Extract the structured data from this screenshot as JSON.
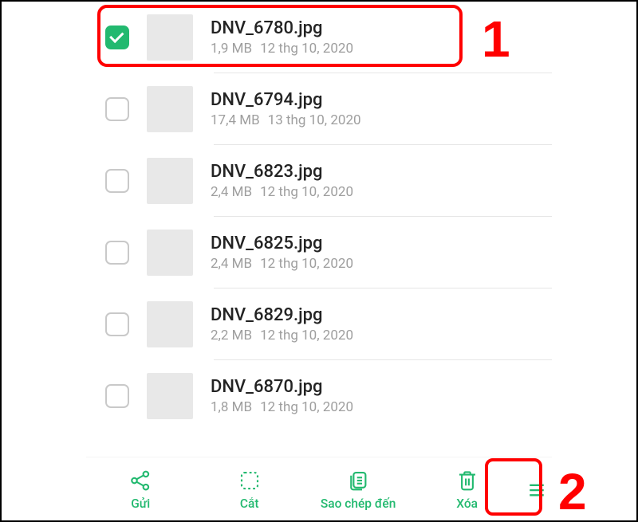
{
  "annotations": {
    "marker1": "1",
    "marker2": "2"
  },
  "files": [
    {
      "name": "DNV_6780.jpg",
      "size": "1,9 MB",
      "date": "12 thg 10, 2020",
      "checked": true
    },
    {
      "name": "DNV_6794.jpg",
      "size": "17,4 MB",
      "date": "13 thg 10, 2020",
      "checked": false
    },
    {
      "name": "DNV_6823.jpg",
      "size": "2,4 MB",
      "date": "12 thg 10, 2020",
      "checked": false
    },
    {
      "name": "DNV_6825.jpg",
      "size": "2,4 MB",
      "date": "12 thg 10, 2020",
      "checked": false
    },
    {
      "name": "DNV_6829.jpg",
      "size": "2,2 MB",
      "date": "12 thg 10, 2020",
      "checked": false
    },
    {
      "name": "DNV_6870.jpg",
      "size": "1,8 MB",
      "date": "12 thg 10, 2020",
      "checked": false
    }
  ],
  "toolbar": {
    "send": "Gửi",
    "cut": "Cắt",
    "copy": "Sao chép đến",
    "delete": "Xóa"
  }
}
